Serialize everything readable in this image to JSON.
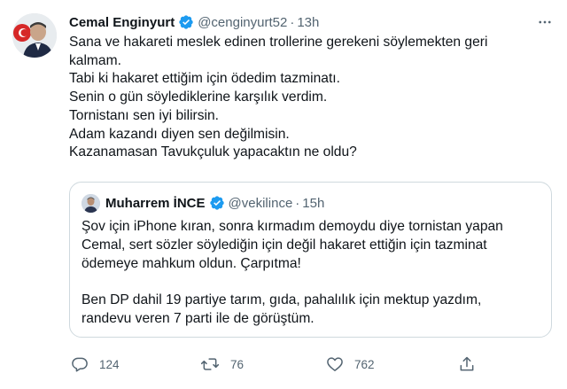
{
  "tweet": {
    "author_name": "Cemal Enginyurt",
    "handle": "@cenginyurt52",
    "separator": "·",
    "time": "13h",
    "lines": [
      "Sana ve hakareti meslek edinen trollerine gerekeni söylemekten geri",
      "kalmam.",
      "Tabi ki hakaret ettiğim için ödedim tazminatı.",
      "Senin o gün söylediklerine karşılık verdim.",
      "Tornistanı sen iyi bilirsin.",
      "Adam kazandı diyen sen değilmisin.",
      "Kazanamasan Tavukçuluk yapacaktın ne oldu?"
    ]
  },
  "quote": {
    "author_name": "Muharrem İNCE",
    "handle": "@vekilince",
    "separator": "·",
    "time": "15h",
    "paragraph1": [
      "Şov için iPhone kıran, sonra kırmadım demoydu diye tornistan yapan",
      "Cemal, sert sözler söylediğin için değil hakaret ettiğin için tazminat",
      "ödemeye mahkum oldun. Çarpıtma!"
    ],
    "paragraph2": [
      "Ben DP dahil 19 partiye tarım, gıda, pahalılık için mektup yazdım,",
      "randevu veren 7 parti ile de görüştüm."
    ]
  },
  "actions": {
    "replies": "124",
    "retweets": "76",
    "likes": "762"
  },
  "icons": {
    "verified": "verified-badge-icon",
    "more": "more-dots-icon",
    "reply": "reply-icon",
    "retweet": "retweet-icon",
    "like": "heart-icon",
    "share": "share-icon"
  },
  "colors": {
    "verified": "#1d9bf0",
    "secondary_text": "#536471",
    "border": "#cfd9de"
  }
}
